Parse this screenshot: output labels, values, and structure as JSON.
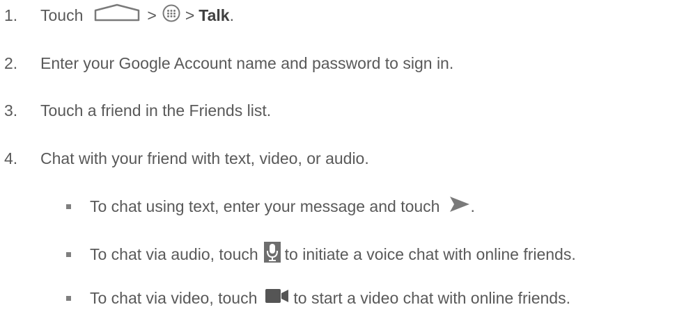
{
  "steps": [
    {
      "number": "1.",
      "text_before": "Touch",
      "sep1": ">",
      "sep2": ">",
      "bold": "Talk",
      "end": ".",
      "icons": [
        "home-icon",
        "apps-icon"
      ]
    },
    {
      "number": "2.",
      "text": "Enter your Google Account name and password to sign in."
    },
    {
      "number": "3.",
      "text": "Touch a friend in the Friends list."
    },
    {
      "number": "4.",
      "text": "Chat with your friend with text, video, or audio."
    }
  ],
  "bullets": [
    {
      "text_before": "To chat using text, enter your message and touch",
      "text_after": ".",
      "icon": "send-icon"
    },
    {
      "text_before": "To chat via audio, touch",
      "text_after": "to initiate a voice chat with online friends.",
      "icon": "microphone-icon"
    },
    {
      "text_before": "To chat via video, touch",
      "text_after": "to start a video chat with online friends.",
      "icon": "video-camera-icon"
    }
  ],
  "colors": {
    "text": "#595959",
    "icon": "#7a7a7a",
    "bullet": "#7f7f7f"
  }
}
